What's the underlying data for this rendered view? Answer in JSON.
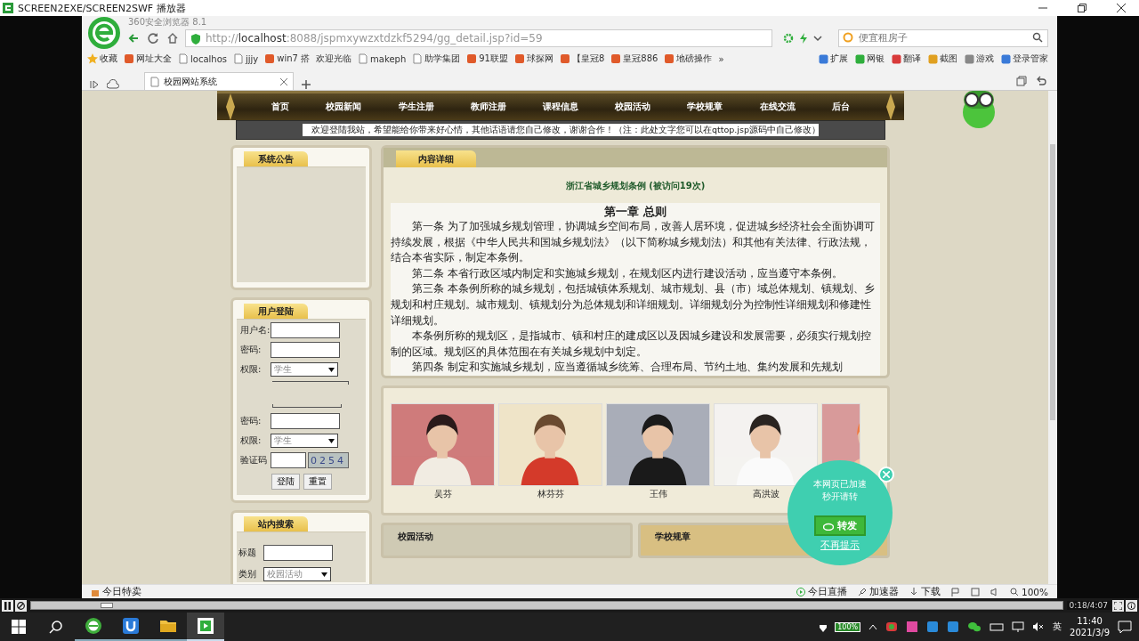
{
  "player": {
    "title": "SCREEN2EXE/SCREEN2SWF 播放器",
    "playing": true,
    "level": 0.073,
    "time": "0:18/4:07"
  },
  "browser": {
    "title": "360安全浏览器 8.1",
    "address": "http://**localhost**:8088/jspmxywzxtdzkf5294/gg_detail.jsp?id=59",
    "search_placeholder": "便宜租房子",
    "bookmarks": [
      {
        "kind": "star",
        "label": "收藏"
      },
      {
        "kind": "site",
        "label": "网址大全"
      },
      {
        "kind": "page",
        "label": "localhos"
      },
      {
        "kind": "page",
        "label": "jjjy"
      },
      {
        "kind": "site",
        "label": "win7 搭"
      },
      {
        "kind": "text",
        "label": "欢迎光临"
      },
      {
        "kind": "page",
        "label": "makeph"
      },
      {
        "kind": "page",
        "label": "助学集团"
      },
      {
        "kind": "site",
        "label": "91联盟"
      },
      {
        "kind": "site",
        "label": "球探网"
      },
      {
        "kind": "site",
        "label": "【皇冠8"
      },
      {
        "kind": "site",
        "label": "皇冠886"
      },
      {
        "kind": "site",
        "label": "地磅操作"
      },
      {
        "kind": "more",
        "label": "»"
      }
    ],
    "tools": [
      "扩展",
      "网银",
      "翻译",
      "截图",
      "游戏",
      "登录管家"
    ],
    "tabs": [
      {
        "label": "校园网站系统",
        "selected": true
      }
    ],
    "status_left": "今日特卖",
    "status_right": [
      {
        "kind": "live",
        "label": "今日直播"
      },
      {
        "kind": "boost",
        "label": "加速器"
      },
      {
        "kind": "download",
        "label": "下载"
      }
    ],
    "zoom": "100%"
  },
  "site": {
    "nav": [
      "首页",
      "校园新闻",
      "学生注册",
      "教师注册",
      "课程信息",
      "校园活动",
      "学校规章",
      "在线交流",
      "后台"
    ],
    "marquee": "欢迎登陆我站，希望能给你带来好心情，其他话语请您自己修改，谢谢合作！（注：此处文字您可以在qttop.jsp源码中自己修改）",
    "notice": {
      "title": "系统公告"
    },
    "login": {
      "title": "用户登陆",
      "rows": [
        {
          "kind": "input",
          "label": "用户名:"
        },
        {
          "kind": "input",
          "label": "密码:"
        },
        {
          "kind": "select",
          "label": "权限:",
          "value": "学生"
        },
        {
          "kind": "overlap"
        },
        {
          "kind": "input",
          "label": "密码:"
        },
        {
          "kind": "select",
          "label": "权限:",
          "value": "学生"
        },
        {
          "kind": "captcha",
          "label": "验证码",
          "code": "0254"
        }
      ],
      "buttons": [
        "登陆",
        "重置"
      ]
    },
    "search": {
      "title": "站内搜索",
      "rows": [
        {
          "kind": "input",
          "label": "标题"
        },
        {
          "kind": "select",
          "label": "类别",
          "value": "校园活动"
        }
      ]
    },
    "article": {
      "tab": "内容详细",
      "title": "浙江省城乡规划条例 (被访问19次)",
      "heading": "第一章  总则",
      "paragraphs": [
        "第一条 为了加强城乡规划管理，协调城乡空间布局，改善人居环境，促进城乡经济社会全面协调可持续发展，根据《中华人民共和国城乡规划法》（以下简称城乡规划法）和其他有关法律、行政法规，结合本省实际，制定本条例。",
        "第二条 本省行政区域内制定和实施城乡规划，在规划区内进行建设活动，应当遵守本条例。",
        "第三条 本条例所称的城乡规划，包括城镇体系规划、城市规划、县（市）域总体规划、镇规划、乡规划和村庄规划。城市规划、镇规划分为总体规划和详细规划。详细规划分为控制性详细规划和修建性详细规划。",
        "本条例所称的规划区，是指城市、镇和村庄的建成区以及因城乡建设和发展需要，必须实行规划控制的区域。规划区的具体范围在有关城乡规划中划定。",
        "第四条 制定和实施城乡规划，应当遵循城乡统筹、合理布局、节约土地、集约发展和先规划"
      ]
    },
    "gallery": [
      {
        "caption": "吴芬",
        "partial": false
      },
      {
        "caption": "林芬芬",
        "partial": false
      },
      {
        "caption": "王伟",
        "partial": false
      },
      {
        "caption": "高洪波",
        "partial": false
      },
      {
        "partial": true
      }
    ],
    "bottom_panels": [
      "校园活动",
      "学校规章"
    ]
  },
  "popup": {
    "lines": [
      "本网页已加速",
      "秒开请转"
    ],
    "button": "转发",
    "dismiss": "不再提示"
  },
  "taskbar": {
    "apps": [
      {
        "kind": "browser",
        "selected": false
      },
      {
        "kind": "store",
        "selected": false
      },
      {
        "kind": "folder",
        "selected": false
      },
      {
        "kind": "recorder",
        "selected": true
      }
    ],
    "battery": "100%",
    "ime": "英",
    "time": "11:40",
    "date": "2021/3/9"
  }
}
